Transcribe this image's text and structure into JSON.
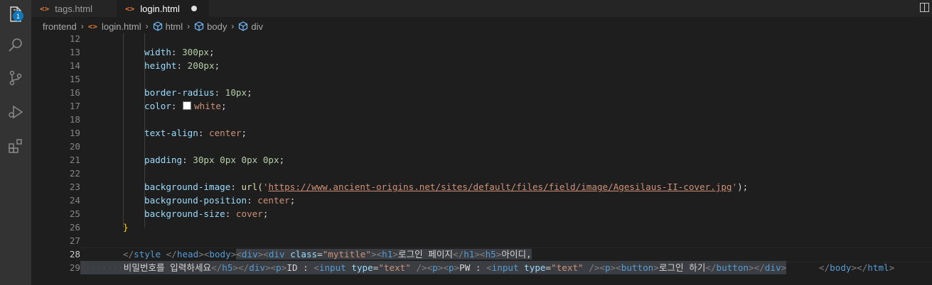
{
  "activity_bar": {
    "explorer_badge": "1"
  },
  "tabs": [
    {
      "label": "tags.html",
      "icon": "html-tag-icon"
    },
    {
      "label": "login.html",
      "icon": "html-tag-icon",
      "active": true,
      "dirty": true
    }
  ],
  "breadcrumb": {
    "items": [
      "frontend",
      "login.html",
      "html",
      "body",
      "div"
    ]
  },
  "editor": {
    "line_numbers": [
      "12",
      "13",
      "14",
      "15",
      "16",
      "17",
      "18",
      "19",
      "20",
      "21",
      "22",
      "23",
      "24",
      "25",
      "26",
      "27",
      "28",
      "29"
    ],
    "current_line": "28",
    "code": {
      "l13": {
        "prop": "width",
        "colon": ": ",
        "num": "300px",
        "semi": ";"
      },
      "l14": {
        "prop": "height",
        "colon": ": ",
        "num": "200px",
        "semi": ";"
      },
      "l16": {
        "prop": "border-radius",
        "colon": ": ",
        "num": "10px",
        "semi": ";"
      },
      "l17": {
        "prop": "color",
        "colon": ": ",
        "val": "white",
        "semi": ";"
      },
      "l19": {
        "prop": "text-align",
        "colon": ": ",
        "val": "center",
        "semi": ";"
      },
      "l21": {
        "prop": "padding",
        "colon": ": ",
        "num": "30px 0px 0px 0px",
        "semi": ";"
      },
      "l23": {
        "prop": "background-image",
        "colon": ": ",
        "fn": "url(",
        "q1": "'",
        "url": "https://www.ancient-origins.net/sites/default/files/field/image/Agesilaus-II-cover.jpg",
        "q2": "'",
        "close": ");"
      },
      "l24": {
        "prop": "background-position",
        "colon": ": ",
        "val": "center",
        "semi": ";"
      },
      "l25": {
        "prop": "background-size",
        "colon": ": ",
        "val": "cover",
        "semi": ";"
      },
      "l26": {
        "brace": "}"
      },
      "l28": {
        "lt1": "</",
        "style": "style",
        "sp1": " ",
        "lt2": "</",
        "head": "head",
        "gt2": ">",
        "lt3": "<",
        "body": "body",
        "gt3": ">",
        "lt4": "<",
        "div1": "div",
        "gt4": ">",
        "lt5": "<",
        "div2": "div",
        "sp2": " ",
        "cls": "class",
        "eq": "=",
        "clsval": "\"mytitle\"",
        "gt5": ">",
        "lt6": "<",
        "h1": "h1",
        "gt6": ">",
        "text1": "로그인 페이지",
        "lt7": "</",
        "h1c": "h1",
        "gt7": ">",
        "lt8": "<",
        "h5": "h5",
        "gt8": ">",
        "text2": "아이디,"
      },
      "l29": {
        "indent": "········",
        "text3": "비밀번호를 입력하세요",
        "lt1": "</",
        "h5c": "h5",
        "gt1": ">",
        "lt2": "</",
        "divc": "div",
        "gt2": ">",
        "lt3": "<",
        "p1": "p",
        "gt3": ">",
        "text4": "ID : ",
        "lt4": "<",
        "input1": "input",
        "sp1": " ",
        "type1": "type",
        "eq1": "=",
        "tval1": "\"text\"",
        "end1": " />",
        "lt5": "<",
        "p2": "p",
        "gt5": ">",
        "lt6": "<",
        "p3": "p",
        "gt6": ">",
        "text5": "PW : ",
        "lt7": "<",
        "input2": "input",
        "sp2": " ",
        "type2": "type",
        "eq2": "=",
        "tval2": "\"text\"",
        "end2": " />",
        "lt8": "<",
        "p4": "p",
        "gt8": ">",
        "lt9": "<",
        "button": "button",
        "gt9": ">",
        "text6": "로그인 하기",
        "lt10": "</",
        "buttonc": "button",
        "gt10": ">",
        "lt11": "</",
        "divc2": "div",
        "gt11": ">",
        "lt12": "</",
        "bodyc": "body",
        "gt12": ">",
        "lt13": "</",
        "htmlc": "html",
        "gt13": ">"
      }
    }
  }
}
